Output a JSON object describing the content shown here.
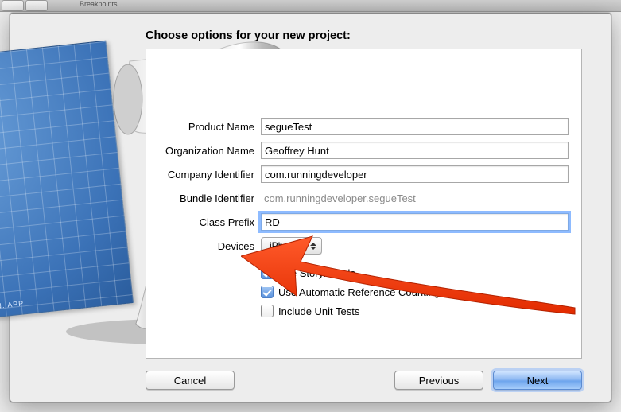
{
  "toolbar": {
    "tab_label": "Breakpoints"
  },
  "title": "Choose options for your new project:",
  "labels": {
    "product_name": "Product Name",
    "organization_name": "Organization Name",
    "company_identifier": "Company Identifier",
    "bundle_identifier": "Bundle Identifier",
    "class_prefix": "Class Prefix",
    "devices": "Devices"
  },
  "values": {
    "product_name": "segueTest",
    "organization_name": "Geoffrey Hunt",
    "company_identifier": "com.runningdeveloper",
    "bundle_identifier": "com.runningdeveloper.segueTest",
    "class_prefix": "RD",
    "devices_selected": "iPhone"
  },
  "checkboxes": {
    "use_storyboards": {
      "label": "Use Storyboards",
      "checked": true
    },
    "use_arc": {
      "label": "Use Automatic Reference Counting",
      "checked": true
    },
    "include_tests": {
      "label": "Include Unit Tests",
      "checked": false
    }
  },
  "buttons": {
    "cancel": "Cancel",
    "previous": "Previous",
    "next": "Next"
  },
  "blueprint_label": "PROJECT: APPLICATION. APP"
}
